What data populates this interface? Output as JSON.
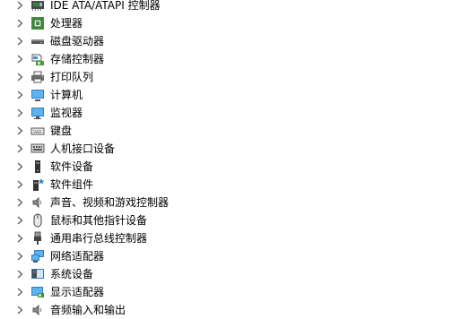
{
  "device_tree": {
    "items": [
      {
        "label": "IDE ATA/ATAPI 控制器",
        "icon": "ide-controller-icon"
      },
      {
        "label": "处理器",
        "icon": "processor-icon"
      },
      {
        "label": "磁盘驱动器",
        "icon": "disk-drive-icon"
      },
      {
        "label": "存储控制器",
        "icon": "storage-controller-icon"
      },
      {
        "label": "打印队列",
        "icon": "printer-icon"
      },
      {
        "label": "计算机",
        "icon": "computer-icon"
      },
      {
        "label": "监视器",
        "icon": "monitor-icon"
      },
      {
        "label": "键盘",
        "icon": "keyboard-icon"
      },
      {
        "label": "人机接口设备",
        "icon": "hid-icon"
      },
      {
        "label": "软件设备",
        "icon": "software-device-icon"
      },
      {
        "label": "软件组件",
        "icon": "software-component-icon"
      },
      {
        "label": "声音、视频和游戏控制器",
        "icon": "speaker-icon"
      },
      {
        "label": "鼠标和其他指针设备",
        "icon": "mouse-icon"
      },
      {
        "label": "通用串行总线控制器",
        "icon": "usb-icon"
      },
      {
        "label": "网络适配器",
        "icon": "network-adapter-icon"
      },
      {
        "label": "系统设备",
        "icon": "system-device-icon"
      },
      {
        "label": "显示适配器",
        "icon": "display-adapter-icon"
      },
      {
        "label": "音频输入和输出",
        "icon": "audio-io-icon"
      }
    ]
  }
}
